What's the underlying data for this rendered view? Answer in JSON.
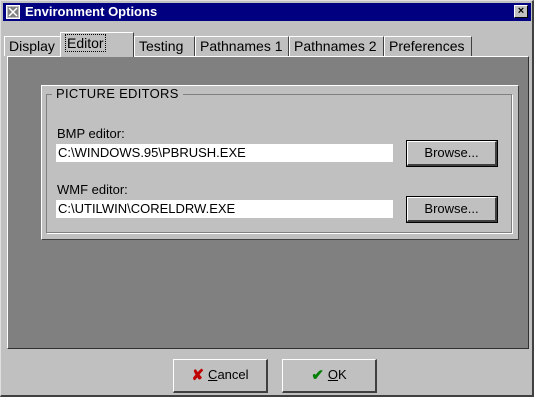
{
  "window": {
    "title": "Environment Options",
    "close_label": "×"
  },
  "tabs": [
    {
      "label": "Display",
      "active": false
    },
    {
      "label": "Editor",
      "active": true
    },
    {
      "label": "Testing",
      "active": false
    },
    {
      "label": "Pathnames 1",
      "active": false
    },
    {
      "label": "Pathnames 2",
      "active": false
    },
    {
      "label": "Preferences",
      "active": false
    }
  ],
  "group": {
    "title": "PICTURE EDITORS",
    "bmp": {
      "label": "BMP editor:",
      "value": "C:\\WINDOWS.95\\PBRUSH.EXE",
      "button": "Browse..."
    },
    "wmf": {
      "label": "WMF editor:",
      "value": "C:\\UTILWIN\\CORELDRW.EXE",
      "button": "Browse..."
    }
  },
  "buttons": {
    "cancel": {
      "icon": "x-icon",
      "accel": "C",
      "rest": "ancel",
      "icon_color": "#c00000"
    },
    "ok": {
      "icon": "check-icon",
      "accel": "O",
      "rest": "K",
      "icon_color": "#008000"
    }
  }
}
